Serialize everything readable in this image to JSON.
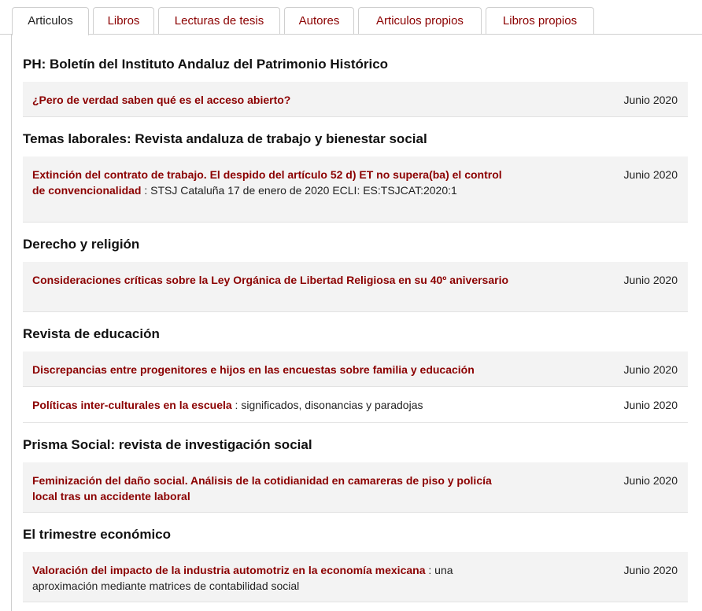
{
  "tabs": [
    {
      "label": "Articulos",
      "active": true
    },
    {
      "label": "Libros"
    },
    {
      "label": "Lecturas de tesis"
    },
    {
      "label": "Autores"
    },
    {
      "label": "Articulos propios"
    },
    {
      "label": "Libros propios"
    }
  ],
  "groups": [
    {
      "journal": "PH: Boletín del Instituto Andaluz del Patrimonio Histórico",
      "articles": [
        {
          "title": "¿Pero de verdad saben qué es el acceso abierto?",
          "subtitle": "",
          "date": "Junio 2020"
        }
      ]
    },
    {
      "journal": "Temas laborales: Revista andaluza de trabajo y bienestar social",
      "articles": [
        {
          "title": "Extinción del contrato de trabajo. El despido del artículo 52 d) ET no supera(ba) el control de convencionalidad",
          "subtitle": " : STSJ Cataluña 17 de enero de 2020 ECLI: ES:TSJCAT:2020:1",
          "date": "Junio 2020"
        }
      ]
    },
    {
      "journal": "Derecho y religión",
      "articles": [
        {
          "title": "Consideraciones críticas sobre la Ley Orgánica de Libertad Religiosa en su 40º aniversario",
          "subtitle": "",
          "date": "Junio 2020"
        }
      ]
    },
    {
      "journal": "Revista de educación",
      "articles": [
        {
          "title": "Discrepancias entre progenitores e hijos en las encuestas sobre familia y educación",
          "subtitle": "",
          "date": "Junio 2020"
        },
        {
          "title": "Políticas inter-culturales en la escuela",
          "subtitle": " : significados, disonancias y paradojas",
          "date": "Junio 2020"
        }
      ]
    },
    {
      "journal": "Prisma Social: revista de investigación social",
      "articles": [
        {
          "title": "Feminización del daño social. Análisis de la cotidianidad en camareras de piso y policía local tras un accidente laboral",
          "subtitle": "",
          "date": "Junio 2020"
        }
      ]
    },
    {
      "journal": "El trimestre económico",
      "articles": [
        {
          "title": "Valoración del impacto de la industria automotriz en la economía mexicana",
          "subtitle": " : una aproximación mediante matrices de contabilidad social",
          "date": "Junio 2020"
        }
      ]
    }
  ]
}
